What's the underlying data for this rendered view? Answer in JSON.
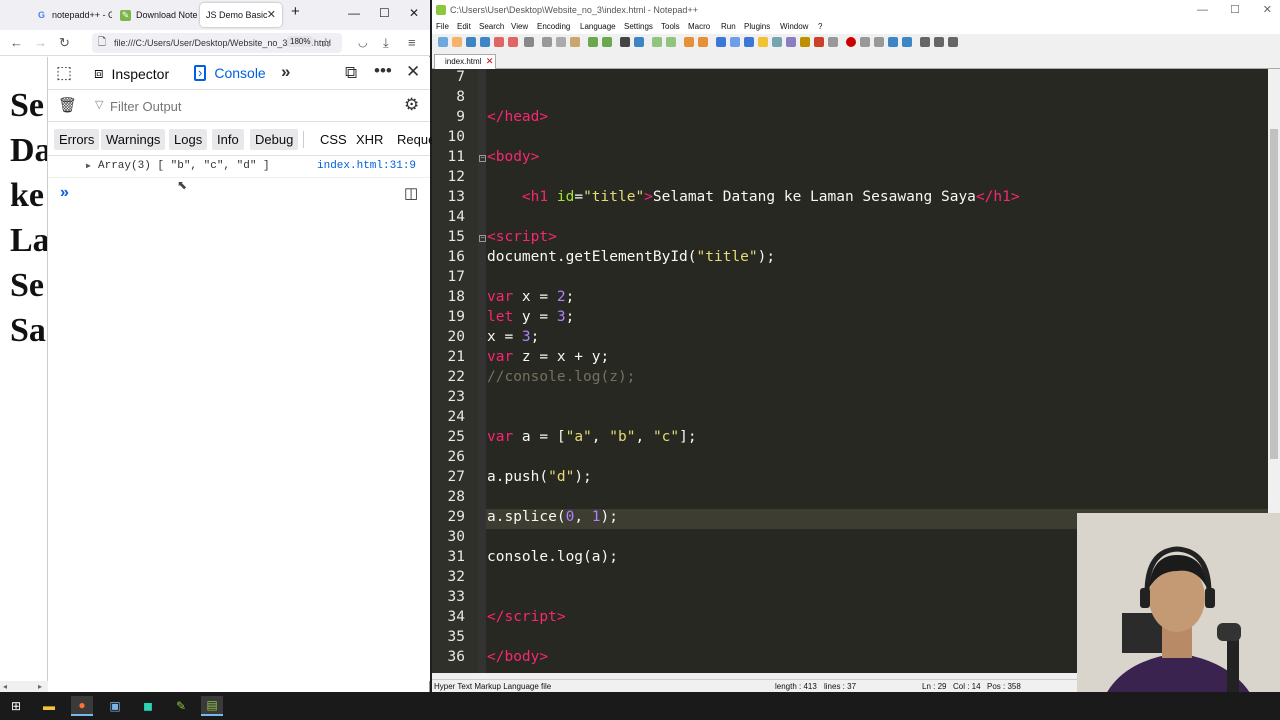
{
  "firefox": {
    "tabs": [
      {
        "label": "notepadd++ - Goo",
        "active": false,
        "icon": "google-icon"
      },
      {
        "label": "Download Notepa",
        "active": false,
        "icon": "notepad-icon"
      },
      {
        "label": "JS Demo Basic",
        "active": true,
        "icon": "none"
      }
    ],
    "url": "file:///C:/Users/User/Desktop/Website_no_3/index.html",
    "zoom": "180%",
    "page_heading_fragments": [
      "Se",
      "Da",
      "ke",
      "La",
      "Se",
      "Sa"
    ],
    "devtools": {
      "tabs": {
        "inspector": "Inspector",
        "console": "Console"
      },
      "filter_placeholder": "Filter Output",
      "levels": [
        "Errors",
        "Warnings",
        "Logs",
        "Info",
        "Debug"
      ],
      "categories": [
        "CSS",
        "XHR",
        "Reque"
      ],
      "log": {
        "text": "Array(3) [ \"b\", \"c\", \"d\" ]",
        "source": "index.html:31:9"
      }
    }
  },
  "notepad": {
    "title": "C:\\Users\\User\\Desktop\\Website_no_3\\index.html - Notepad++",
    "menu": [
      "File",
      "Edit",
      "Search",
      "View",
      "Encoding",
      "Language",
      "Settings",
      "Tools",
      "Macro",
      "Run",
      "Plugins",
      "Window",
      "?"
    ],
    "tab": "index.html",
    "status": {
      "language": "Hyper Text Markup Language file",
      "length": "length : 413",
      "lines": "lines : 37",
      "ln": "Ln : 29",
      "col": "Col : 14",
      "pos": "Pos : 358"
    },
    "line_numbers": [
      "7",
      "8",
      "9",
      "10",
      "11",
      "12",
      "13",
      "14",
      "15",
      "16",
      "17",
      "18",
      "19",
      "20",
      "21",
      "22",
      "23",
      "24",
      "25",
      "26",
      "27",
      "28",
      "29",
      "30",
      "31",
      "32",
      "33",
      "34",
      "35",
      "36"
    ]
  }
}
